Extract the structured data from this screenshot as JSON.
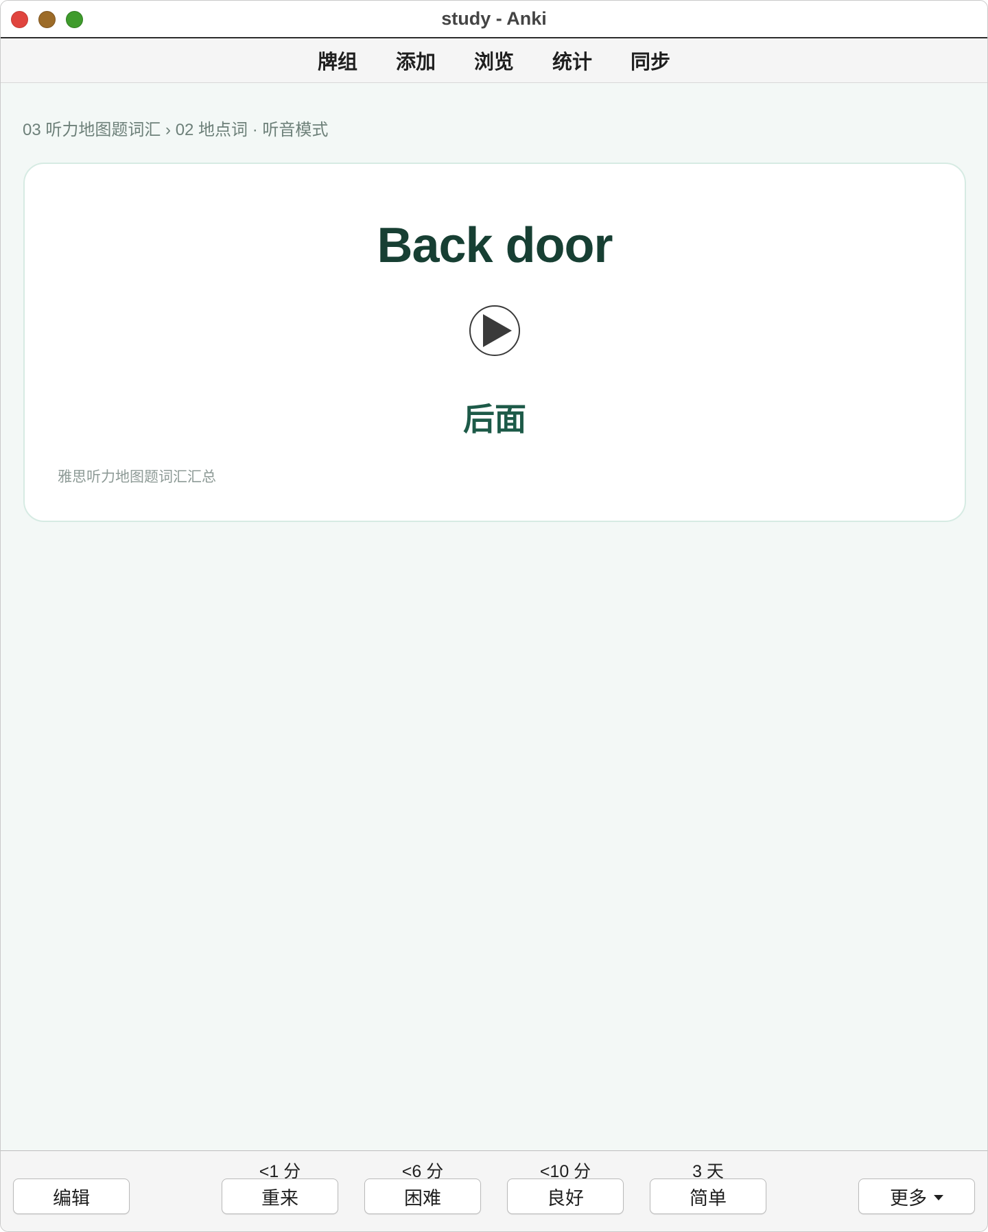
{
  "window": {
    "title": "study - Anki"
  },
  "toolbar": {
    "items": [
      {
        "label": "牌组"
      },
      {
        "label": "添加"
      },
      {
        "label": "浏览"
      },
      {
        "label": "统计"
      },
      {
        "label": "同步"
      }
    ]
  },
  "breadcrumb": "03 听力地图题词汇 › 02 地点词 · 听音模式",
  "card": {
    "word": "Back door",
    "translation": "后面",
    "source": "雅思听力地图题词汇汇总",
    "audio_icon": "play-icon"
  },
  "bottom": {
    "edit_label": "编辑",
    "more_label": "更多",
    "answers": [
      {
        "interval": "<1 分",
        "label": "重来"
      },
      {
        "interval": "<6 分",
        "label": "困难"
      },
      {
        "interval": "<10 分",
        "label": "良好"
      },
      {
        "interval": "3 天",
        "label": "简单"
      }
    ]
  },
  "colors": {
    "background": "#f3f8f6",
    "word": "#173f33",
    "translation": "#1d5a48",
    "card_border": "#d6ebe3"
  }
}
